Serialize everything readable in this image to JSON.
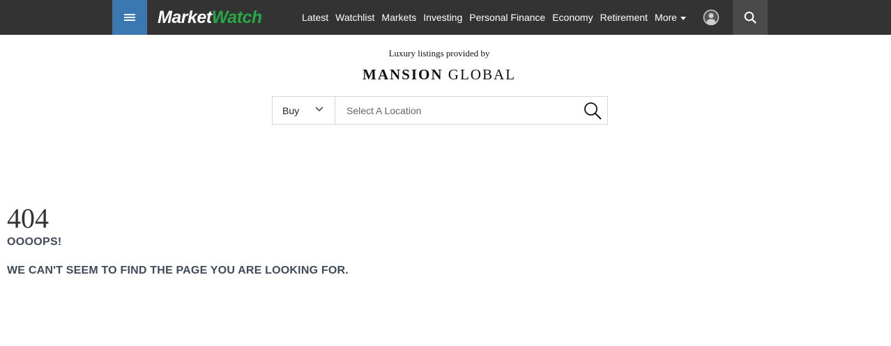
{
  "header": {
    "menu_icon": "hamburger-menu-icon",
    "logo": {
      "part1": "Market",
      "part2": "Watch",
      "color_part2": "#27a844"
    },
    "nav_items": [
      "Latest",
      "Watchlist",
      "Markets",
      "Investing",
      "Personal Finance",
      "Economy",
      "Retirement"
    ],
    "more_label": "More",
    "user_icon": "user-avatar-icon",
    "search_icon": "search-icon",
    "colors": {
      "bar": "#333333",
      "menu_button": "#3b78b2",
      "search_button": "#4a4a4a"
    }
  },
  "listings_widget": {
    "provided_by": "Luxury listings provided by",
    "brand_part1": "MANSION",
    "brand_part2": "GLOBAL",
    "type_select_value": "Buy",
    "location_placeholder": "Select A Location",
    "search_icon": "magnifier-icon"
  },
  "error": {
    "code": "404",
    "headline": "OOOOPS!",
    "message": "WE CAN'T SEEM TO FIND THE PAGE YOU ARE LOOKING FOR."
  }
}
